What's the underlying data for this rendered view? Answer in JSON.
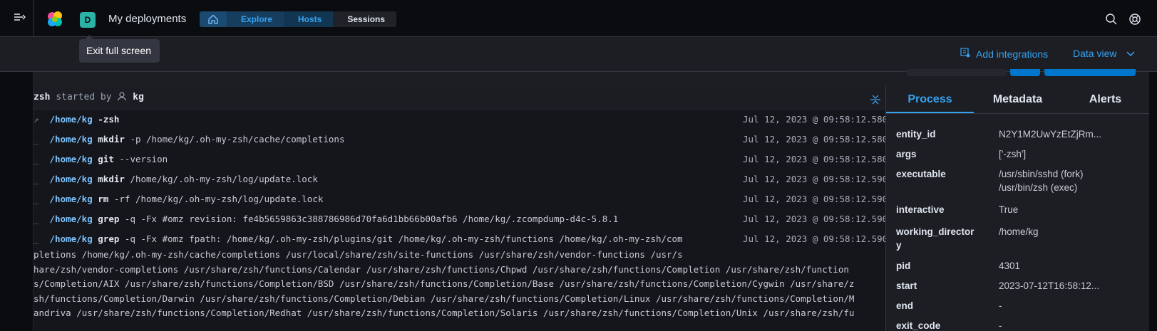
{
  "header": {
    "deployment_initial": "D",
    "deployment_title": "My deployments",
    "breadcrumbs": [
      "Explore",
      "Hosts",
      "Sessions"
    ]
  },
  "tooltip": "Exit full screen",
  "toolbar": {
    "add_integrations": "Add integrations",
    "data_view": "Data view"
  },
  "session": {
    "process": "zsh",
    "started_by": "started by",
    "user": "kg"
  },
  "rows": [
    {
      "prefix": "↗",
      "dir": "/home/kg",
      "cmd": "-zsh",
      "args": "",
      "ts": "Jul 12, 2023 @ 09:58:12.580"
    },
    {
      "prefix": "_",
      "dir": "/home/kg",
      "cmd": "mkdir",
      "args": "-p /home/kg/.oh-my-zsh/cache/completions",
      "ts": "Jul 12, 2023 @ 09:58:12.580"
    },
    {
      "prefix": "_",
      "dir": "/home/kg",
      "cmd": "git",
      "args": "--version",
      "ts": "Jul 12, 2023 @ 09:58:12.580"
    },
    {
      "prefix": "_",
      "dir": "/home/kg",
      "cmd": "mkdir",
      "args": "/home/kg/.oh-my-zsh/log/update.lock",
      "ts": "Jul 12, 2023 @ 09:58:12.590"
    },
    {
      "prefix": "_",
      "dir": "/home/kg",
      "cmd": "rm",
      "args": "-rf /home/kg/.oh-my-zsh/log/update.lock",
      "ts": "Jul 12, 2023 @ 09:58:12.590"
    },
    {
      "prefix": "_",
      "dir": "/home/kg",
      "cmd": "grep",
      "args": "-q -Fx #omz revision: fe4b5659863c388786986d70fa6d1bb66b00afb6 /home/kg/.zcompdump-d4c-5.8.1",
      "ts": "Jul 12, 2023 @ 09:58:12.590"
    },
    {
      "prefix": "_",
      "dir": "/home/kg",
      "cmd": "grep",
      "args": "-q -Fx #omz fpath: /home/kg/.oh-my-zsh/plugins/git /home/kg/.oh-my-zsh/functions /home/kg/.oh-my-zsh/com",
      "ts": "Jul 12, 2023 @ 09:58:12.590"
    }
  ],
  "continuation": [
    "pletions /home/kg/.oh-my-zsh/cache/completions /usr/local/share/zsh/site-functions /usr/share/zsh/vendor-functions /usr/s",
    "hare/zsh/vendor-completions /usr/share/zsh/functions/Calendar /usr/share/zsh/functions/Chpwd /usr/share/zsh/functions/Completion /usr/share/zsh/function",
    "s/Completion/AIX /usr/share/zsh/functions/Completion/BSD /usr/share/zsh/functions/Completion/Base /usr/share/zsh/functions/Completion/Cygwin /usr/share/z",
    "sh/functions/Completion/Darwin /usr/share/zsh/functions/Completion/Debian /usr/share/zsh/functions/Completion/Linux /usr/share/zsh/functions/Completion/M",
    "andriva /usr/share/zsh/functions/Completion/Redhat /usr/share/zsh/functions/Completion/Solaris /usr/share/zsh/functions/Completion/Unix /usr/share/zsh/fu"
  ],
  "panel": {
    "tabs": [
      "Process",
      "Metadata",
      "Alerts"
    ],
    "fields": [
      {
        "k": "entity_id",
        "v": "N2Y1M2UwYzEtZjRm..."
      },
      {
        "k": "args",
        "v": "['-zsh']"
      },
      {
        "k": "executable",
        "v": "/usr/sbin/sshd (fork)\n/usr/bin/zsh (exec)"
      },
      {
        "k": "interactive",
        "v": "True"
      },
      {
        "k": "working_directory",
        "v": "/home/kg"
      },
      {
        "k": "pid",
        "v": "4301"
      },
      {
        "k": "start",
        "v": "2023-07-12T16:58:12..."
      },
      {
        "k": "end",
        "v": "-"
      },
      {
        "k": "exit_code",
        "v": "-"
      }
    ]
  },
  "colors": {
    "accent": "#36a2ef",
    "background": "#1d1e24",
    "topbar": "#0b0c10",
    "avatar": "#2bb3a6"
  }
}
